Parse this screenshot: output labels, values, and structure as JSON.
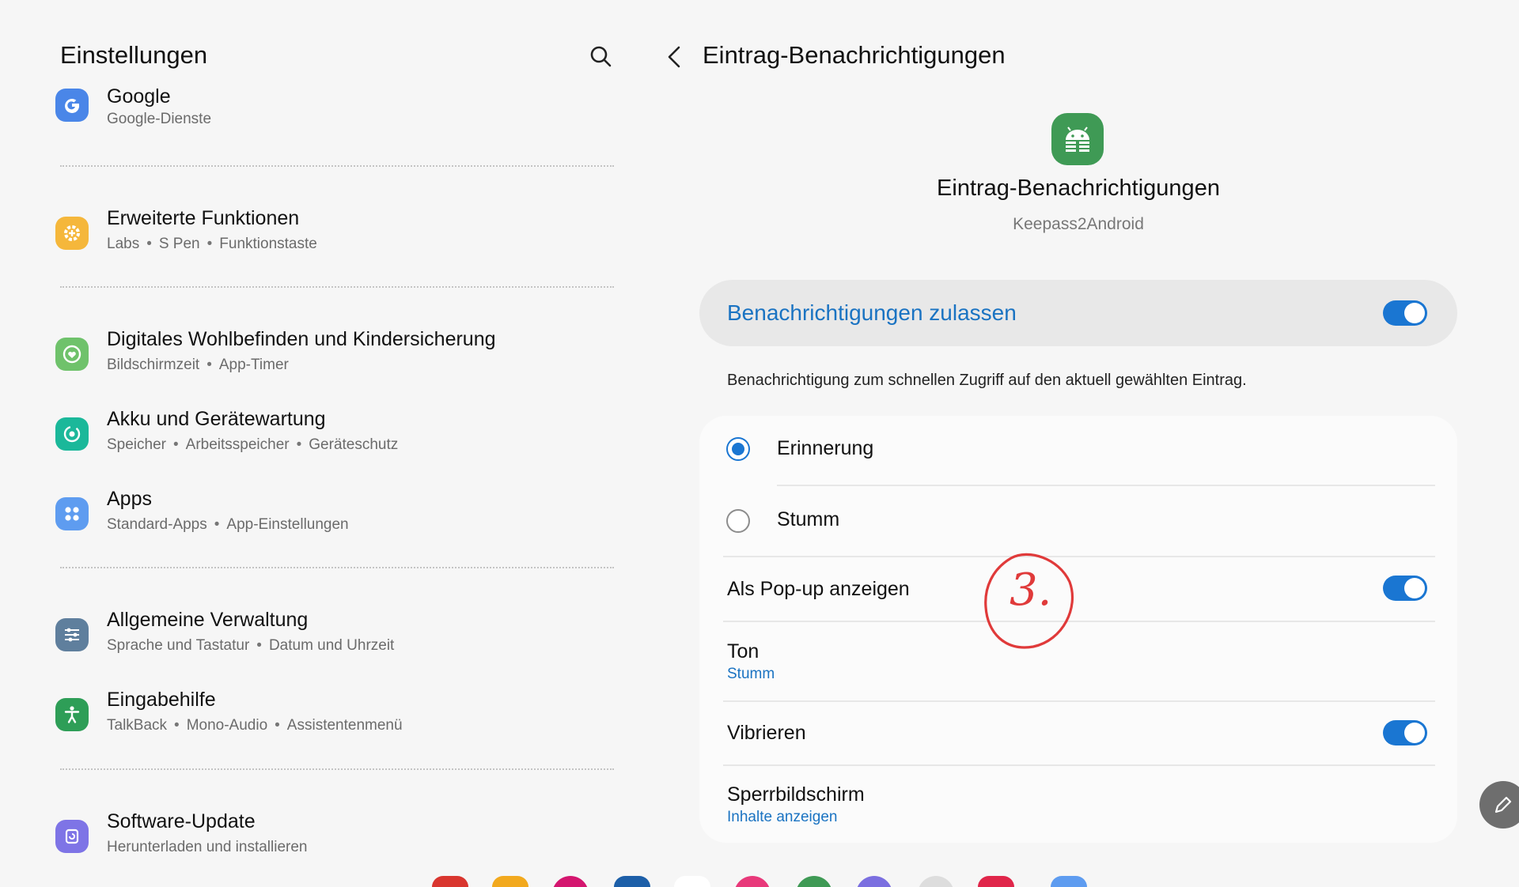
{
  "left": {
    "title": "Einstellungen",
    "items": [
      {
        "title": "Google",
        "subs": [
          "Google-Dienste"
        ],
        "icon": "google-icon",
        "color": "#4a86e8"
      },
      {
        "title": "Erweiterte Funktionen",
        "subs": [
          "Labs",
          "S Pen",
          "Funktionstaste"
        ],
        "icon": "gear-plus-icon",
        "color": "#f5b73b"
      },
      {
        "title": "Digitales Wohlbefinden und Kindersicherung",
        "subs": [
          "Bildschirmzeit",
          "App-Timer"
        ],
        "icon": "wellbeing-icon",
        "color": "#6fc26b"
      },
      {
        "title": "Akku und Gerätewartung",
        "subs": [
          "Speicher",
          "Arbeitsspeicher",
          "Geräteschutz"
        ],
        "icon": "device-care-icon",
        "color": "#1bb89a"
      },
      {
        "title": "Apps",
        "subs": [
          "Standard-Apps",
          "App-Einstellungen"
        ],
        "icon": "apps-icon",
        "color": "#5e9cf0"
      },
      {
        "title": "Allgemeine Verwaltung",
        "subs": [
          "Sprache und Tastatur",
          "Datum und Uhrzeit"
        ],
        "icon": "sliders-icon",
        "color": "#5f7f9d"
      },
      {
        "title": "Eingabehilfe",
        "subs": [
          "TalkBack",
          "Mono-Audio",
          "Assistentenmenü"
        ],
        "icon": "accessibility-icon",
        "color": "#2e9e57"
      },
      {
        "title": "Software-Update",
        "subs": [
          "Herunterladen und installieren"
        ],
        "icon": "update-icon",
        "color": "#7e74e6"
      }
    ]
  },
  "right": {
    "title": "Eintrag-Benachrichtigungen",
    "app_name": "Eintrag-Benachrichtigungen",
    "app_package": "Keepass2Android",
    "allow_label": "Benachrichtigungen zulassen",
    "allow_on": true,
    "description": "Benachrichtigung zum schnellen Zugriff auf den aktuell gewählten Eintrag.",
    "options": {
      "alert_label": "Erinnerung",
      "silent_label": "Stumm",
      "selected": "Erinnerung",
      "popup_label": "Als Pop-up anzeigen",
      "popup_on": true,
      "sound_label": "Ton",
      "sound_value": "Stumm",
      "vibrate_label": "Vibrieren",
      "vibrate_on": true,
      "lockscreen_label": "Sperrbildschirm",
      "lockscreen_value": "Inhalte anzeigen"
    },
    "annotation": "3."
  },
  "colors": {
    "accent": "#1a76d2",
    "annotation": "#e03a3a",
    "app_icon": "#3f9a55"
  }
}
